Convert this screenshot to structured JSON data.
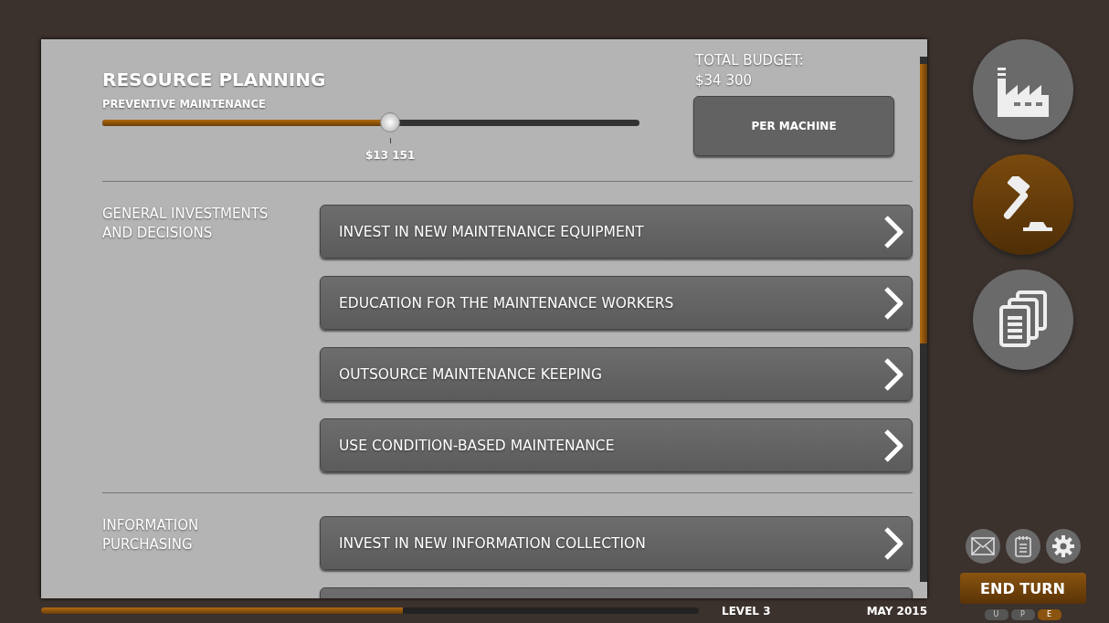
{
  "header": {
    "title": "RESOURCE PLANNING",
    "slider": {
      "label": "PREVENTIVE MAINTENANCE",
      "level": 0.536,
      "reading": "$13 151"
    },
    "budget_label": "TOTAL BUDGET:",
    "budget_value": "$34 300",
    "mode_button": "PER MACHINE"
  },
  "sections": [
    {
      "title": "GENERAL INVESTMENTS AND DECISIONS",
      "items": [
        "INVEST IN NEW MAINTENANCE EQUIPMENT",
        "EDUCATION FOR THE MAINTENANCE WORKERS",
        "OUTSOURCE MAINTENANCE KEEPING",
        "USE CONDITION-BASED MAINTENANCE"
      ]
    },
    {
      "title": "INFORMATION PURCHASING",
      "items": [
        "INVEST IN NEW INFORMATION COLLECTION"
      ]
    }
  ],
  "side_nav": [
    {
      "kind": "factory",
      "selected": false
    },
    {
      "kind": "gavel",
      "selected": true
    },
    {
      "kind": "documents",
      "selected": false
    }
  ],
  "tools": [
    {
      "kind": "mail"
    },
    {
      "kind": "notepad"
    },
    {
      "kind": "settings"
    }
  ],
  "end_turn": "END TURN",
  "phases": [
    {
      "label": "U",
      "selected": false
    },
    {
      "label": "P",
      "selected": false
    },
    {
      "label": "E",
      "selected": true
    }
  ],
  "status_bar": {
    "progress": {
      "level": 0.55
    },
    "level": "LEVEL 3",
    "date": "MAY 2015"
  }
}
